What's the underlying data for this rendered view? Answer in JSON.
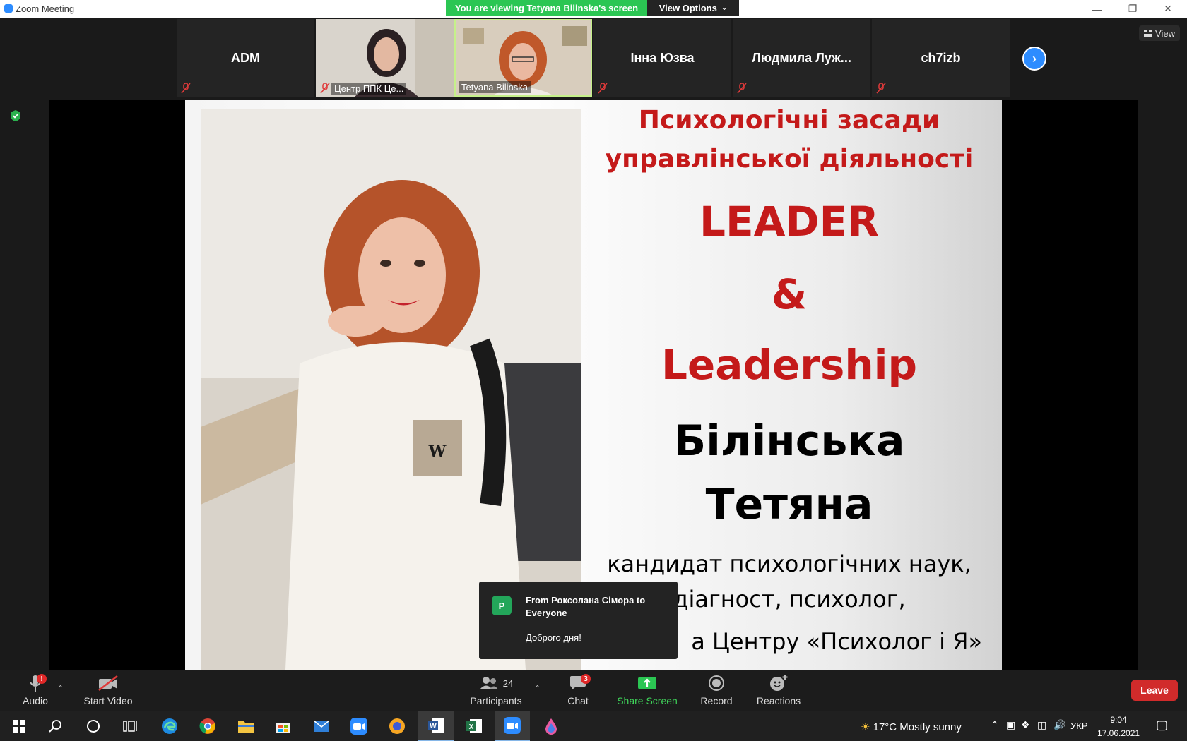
{
  "window": {
    "title": "Zoom Meeting",
    "minimize": "—",
    "maximize": "❐",
    "close": "✕"
  },
  "banner": {
    "viewing": "You are viewing Tetyana Bilinska's screen",
    "view_options": "View Options"
  },
  "gallery": {
    "tiles": [
      {
        "name": "ADM"
      },
      {
        "label": "Центр ППК Це..."
      },
      {
        "label": "Tetyana Bilinska"
      },
      {
        "name": "Інна Юзва"
      },
      {
        "name": "Людмила  Луж..."
      },
      {
        "name": "ch7izb"
      }
    ],
    "view_label": "View"
  },
  "slide": {
    "title_line1": "Психологічні засади",
    "title_line2": "управлінської діяльності",
    "leader": "LEADER",
    "amp": "&",
    "leadership": "Leadership",
    "surname": "Білінська",
    "name": "Тетяна",
    "desc1": "кандидат психологічних наук,",
    "desc2": "діагност, психолог,",
    "desc3": "а Центру «Психолог і Я»",
    "accent_color": "#c41a1a"
  },
  "chat_toast": {
    "avatar": "P",
    "from": "From Роксолана Сімора to Everyone",
    "message": "Доброго дня!"
  },
  "toolbar": {
    "audio": "Audio",
    "audio_badge": "!",
    "start_video": "Start Video",
    "participants": "Participants",
    "participants_count": "24",
    "chat": "Chat",
    "chat_badge": "3",
    "share_screen": "Share Screen",
    "record": "Record",
    "reactions": "Reactions",
    "leave": "Leave"
  },
  "taskbar": {
    "weather": "17°C  Mostly sunny",
    "lang": "УКР",
    "time": "9:04",
    "date": "17.06.2021"
  }
}
